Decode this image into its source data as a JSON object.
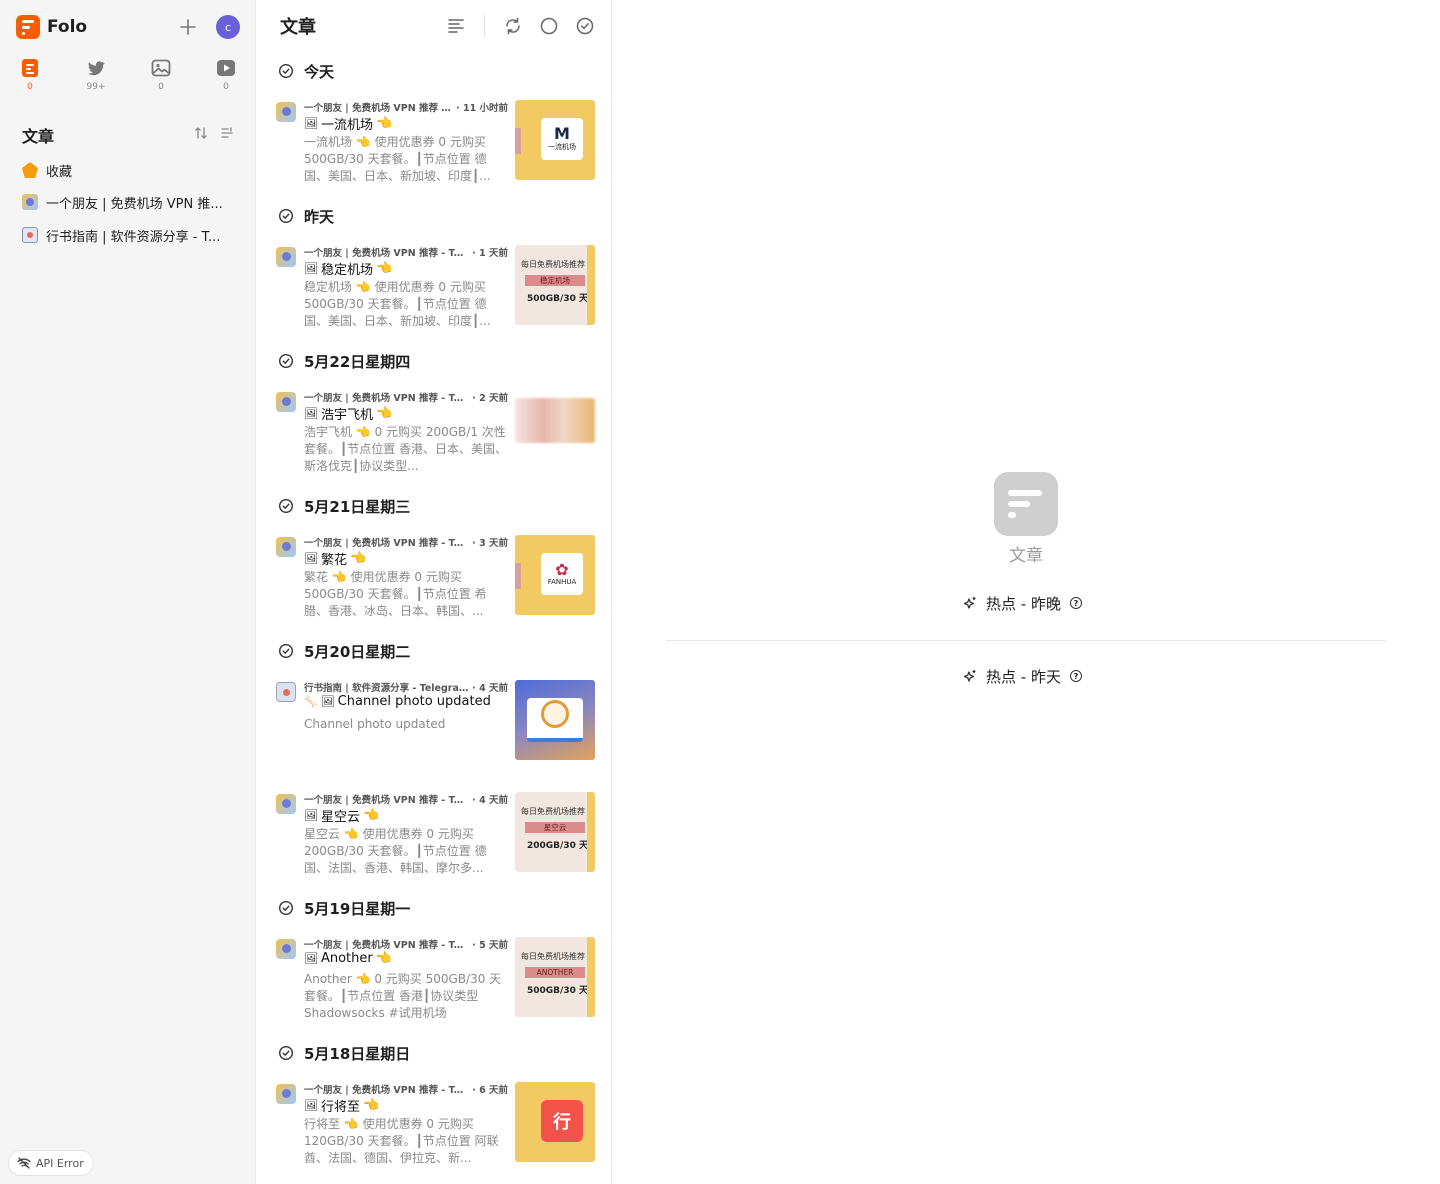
{
  "app": {
    "name": "Folo",
    "avatar_letter": "c",
    "accent": "#ff5c00"
  },
  "views": [
    {
      "name": "articles",
      "icon": "article-icon",
      "count": "0",
      "active": true
    },
    {
      "name": "social",
      "icon": "twitter-bird-icon",
      "count": "99+",
      "active": false
    },
    {
      "name": "pictures",
      "icon": "image-icon",
      "count": "0",
      "active": false
    },
    {
      "name": "videos",
      "icon": "video-play-icon",
      "count": "0",
      "active": false
    }
  ],
  "sidebar": {
    "section_title": "文章",
    "items": [
      {
        "label": "收藏",
        "icon": "star-icon"
      },
      {
        "label": "一个朋友 | 免费机场 VPN 推荐 - Telegram Channel",
        "display": "一个朋友 | 免费机场 VPN 推..."
      },
      {
        "label": "行书指南 | 软件资源分享 - Telegram Channel",
        "display": "行书指南 | 软件资源分享 - T..."
      }
    ],
    "api_error": "API Error"
  },
  "list": {
    "title": "文章",
    "groups": [
      {
        "date": "今天"
      },
      {
        "date": "昨天"
      },
      {
        "date": "5月22日星期四"
      },
      {
        "date": "5月21日星期三"
      },
      {
        "date": "5月20日星期二"
      },
      {
        "date": "5月19日星期一"
      },
      {
        "date": "5月18日星期日"
      }
    ],
    "entries": [
      {
        "source": "一个朋友 | 免费机场 VPN 推荐 -...",
        "time": "· 11 小时前",
        "title": "一流机场",
        "desc": "一流机场 👈 使用优惠券 0 元购买 500GB/30 天套餐。┃节点位置 德国、美国、日本、新加坡、印度┃...",
        "thumb_text": "一流机场",
        "thumb_mark": "M"
      },
      {
        "source": "一个朋友 | 免费机场 VPN 推荐 - Tel...",
        "time": "· 1 天前",
        "title": "稳定机场",
        "desc": "稳定机场 👈 使用优惠券 0 元购买 500GB/30 天套餐。┃节点位置 德国、美国、日本、新加坡、印度┃...",
        "thumb_l1": "每日免费机场推荐",
        "thumb_l2": "稳定机场",
        "thumb_l3": "500GB/30 天"
      },
      {
        "source": "一个朋友 | 免费机场 VPN 推荐 - Te...",
        "time": "· 2 天前",
        "title": "浩宇飞机",
        "desc": "浩宇飞机 👈 0 元购买 200GB/1 次性套餐。┃节点位置 香港、日本、美国、斯洛伐克┃协议类型..."
      },
      {
        "source": "一个朋友 | 免费机场 VPN 推荐 - Te...",
        "time": "· 3 天前",
        "title": "繁花",
        "desc": "繁花 👈 使用优惠券 0 元购买 500GB/30 天套餐。┃节点位置 希腊、香港、冰岛、日本、韩国、...",
        "thumb_text": "FANHUA",
        "thumb_mark": "✿"
      },
      {
        "source": "行书指南 | 软件资源分享 - Telegra...",
        "time": "· 4 天前",
        "title": "Channel photo updated",
        "desc": "Channel photo updated"
      },
      {
        "source": "一个朋友 | 免费机场 VPN 推荐 - Te...",
        "time": "· 4 天前",
        "title": "星空云",
        "desc": "星空云 👈 使用优惠券 0 元购买 200GB/30 天套餐。┃节点位置 德国、法国、香港、韩国、摩尔多...",
        "thumb_l1": "每日免费机场推荐",
        "thumb_l2": "星空云",
        "thumb_l3": "200GB/30 天"
      },
      {
        "source": "一个朋友 | 免费机场 VPN 推荐 - Te...",
        "time": "· 5 天前",
        "title": "Another",
        "desc": "Another 👈 0 元购买 500GB/30 天套餐。┃节点位置 香港┃协议类型 Shadowsocks #试用机场",
        "thumb_l1": "每日免费机场推荐",
        "thumb_l2": "ANOTHER",
        "thumb_l3": "500GB/30 天"
      },
      {
        "source": "一个朋友 | 免费机场 VPN 推荐 - Te...",
        "time": "· 6 天前",
        "title": "行将至",
        "desc": "行将至 👈 使用优惠券 0 元购买 120GB/30 天套餐。┃节点位置 阿联酋、法国、德国、伊拉克、新...",
        "thumb_mark": "行"
      }
    ]
  },
  "content": {
    "empty_label": "文章",
    "hot_last_night": "热点 - 昨晚",
    "hot_yesterday": "热点 - 昨天",
    "help_glyph": "?"
  }
}
